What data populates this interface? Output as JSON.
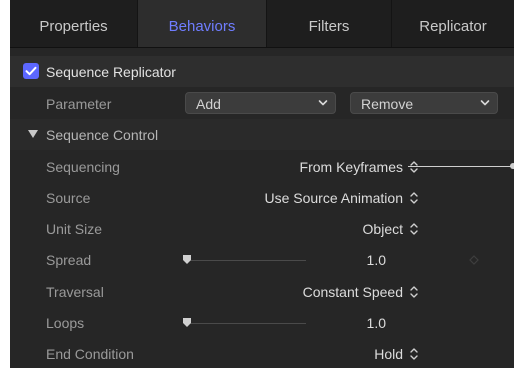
{
  "tabs": [
    {
      "label": "Properties",
      "active": false
    },
    {
      "label": "Behaviors",
      "active": true
    },
    {
      "label": "Filters",
      "active": false
    },
    {
      "label": "Replicator",
      "active": false
    }
  ],
  "behavior": {
    "title": "Sequence Replicator",
    "enabled": true
  },
  "parameter": {
    "label": "Parameter",
    "add_label": "Add",
    "remove_label": "Remove"
  },
  "section": {
    "title": "Sequence Control",
    "expanded": true
  },
  "rows": {
    "sequencing": {
      "label": "Sequencing",
      "value": "From Keyframes"
    },
    "source": {
      "label": "Source",
      "value": "Use Source Animation"
    },
    "unit_size": {
      "label": "Unit Size",
      "value": "Object"
    },
    "spread": {
      "label": "Spread",
      "value": "1.0",
      "slider_fraction": 0.0
    },
    "traversal": {
      "label": "Traversal",
      "value": "Constant Speed"
    },
    "loops": {
      "label": "Loops",
      "value": "1.0",
      "slider_fraction": 0.0
    },
    "end_condition": {
      "label": "End Condition",
      "value": "Hold"
    }
  },
  "colors": {
    "panel_bg": "#262626",
    "accent": "#6f7dff",
    "checkbox": "#5c67ff",
    "label": "#9a9a9a",
    "value": "#dcdcdc"
  },
  "icons": {
    "checkbox": "checkmark-icon",
    "disclosure": "disclosure-triangle-icon",
    "popup": "updown-chevron-icon",
    "dropdown": "chevron-down-icon",
    "keyframe": "keyframe-diamond-icon"
  }
}
